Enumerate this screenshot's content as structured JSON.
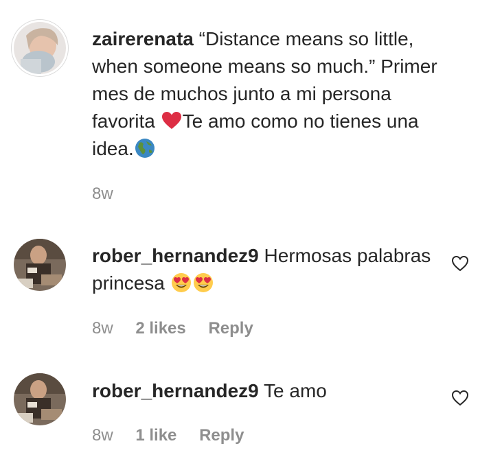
{
  "comments": [
    {
      "username": "zairerenata",
      "text_part1": "“Distance means so little, when someone means so much.” Primer mes de muchos junto a mi persona favorita ",
      "emoji1": "red-heart",
      "text_part2": "Te amo como no tienes una idea.",
      "emoji2": "globe-americas",
      "time": "8w"
    },
    {
      "username": "rober_hernandez9",
      "text": "Hermosas palabras princesa ",
      "emoji1": "heart-eyes",
      "emoji2": "heart-eyes",
      "time": "8w",
      "likes": "2 likes",
      "reply": "Reply"
    },
    {
      "username": "rober_hernandez9",
      "text": "Te amo",
      "time": "8w",
      "likes": "1 like",
      "reply": "Reply"
    }
  ],
  "colors": {
    "text": "#262626",
    "secondary": "#8e8e8e"
  }
}
